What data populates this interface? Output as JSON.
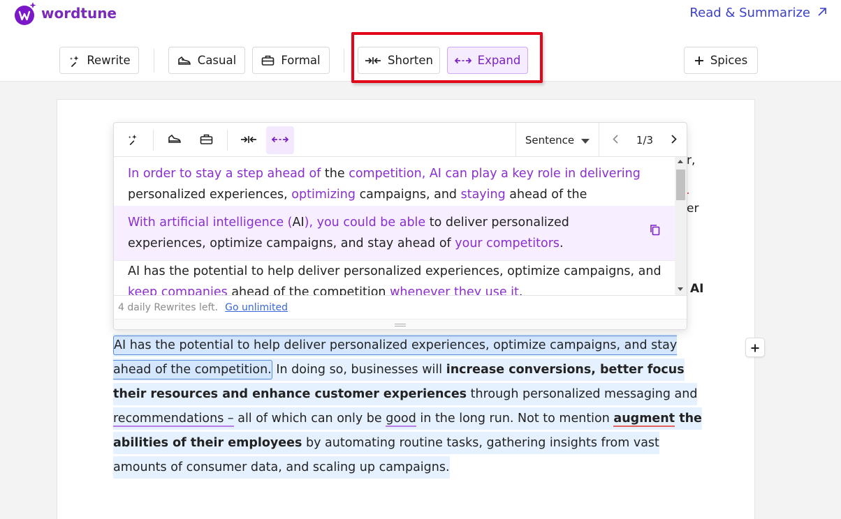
{
  "app": {
    "brand": "wordtune",
    "read_link": "Read & Summarize"
  },
  "toolbar": {
    "rewrite": "Rewrite",
    "casual": "Casual",
    "formal": "Formal",
    "shorten": "Shorten",
    "expand": "Expand",
    "spices": "Spices"
  },
  "popup": {
    "mode": "Sentence",
    "pager": "1/3",
    "suggestions": [
      {
        "parts": [
          {
            "t": "In order to stay a step ahead of",
            "c": "p"
          },
          {
            "t": " the ",
            "c": ""
          },
          {
            "t": "competition, AI can play a key role in delivering",
            "c": "p"
          },
          {
            "t": " personalized experiences, ",
            "c": ""
          },
          {
            "t": "optimizing",
            "c": "p"
          },
          {
            "t": " campaigns, and ",
            "c": ""
          },
          {
            "t": "staying",
            "c": "p"
          },
          {
            "t": " ahead of the competition.",
            "c": ""
          }
        ]
      },
      {
        "parts": [
          {
            "t": "With artificial intelligence (",
            "c": "p"
          },
          {
            "t": "AI",
            "c": ""
          },
          {
            "t": "), you could be able",
            "c": "p"
          },
          {
            "t": " to deliver personalized experiences, optimize campaigns, and stay ahead of ",
            "c": ""
          },
          {
            "t": "your competitors",
            "c": "p"
          },
          {
            "t": ".",
            "c": ""
          }
        ]
      },
      {
        "parts": [
          {
            "t": "AI has the potential to help deliver personalized experiences, optimize campaigns, and ",
            "c": ""
          },
          {
            "t": "keep companies",
            "c": "p"
          },
          {
            "t": " ahead of the competition ",
            "c": ""
          },
          {
            "t": "whenever they use it",
            "c": "p"
          },
          {
            "t": ".",
            "c": ""
          }
        ]
      }
    ],
    "rewrites_left": "4 daily Rewrites left.",
    "go_unlimited": "Go unlimited"
  },
  "document": {
    "peek_1": "r,",
    "peek_2": "er",
    "peek_3": "AI",
    "para_sentence": "AI has the potential to help deliver personalized experiences, optimize campaigns, and stay ahead of the competition.",
    "para_rest_1": " In doing so, businesses will ",
    "para_bold_1": "increase conversions, better focus their resources and enhance customer experiences",
    "para_rest_2": " through personalized messaging and ",
    "para_ul_1": "recommendations –",
    "para_rest_3": " all of which can only be ",
    "para_ul_2": "good",
    "para_rest_4": " in the long run. Not to mention ",
    "para_ul_3": "augment",
    "para_bold_2": " the abilities of their employees",
    "para_rest_5": " by automating routine tasks, gathering insights from vast amounts of consumer data, and scaling up campaigns."
  },
  "colors": {
    "brand_purple": "#7b22c6",
    "link_blue": "#3b3fc9",
    "highlight_red": "#e2061b",
    "selection_blue": "#d4e7ff"
  }
}
